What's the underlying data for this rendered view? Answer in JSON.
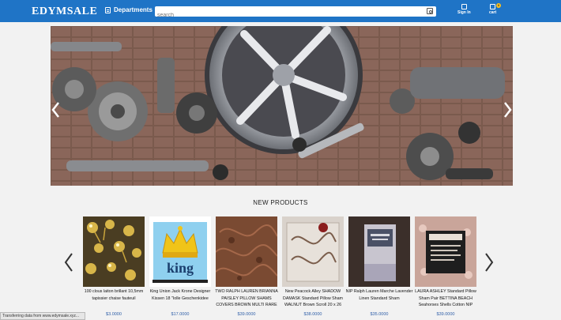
{
  "header": {
    "logo": "EDYMSALE",
    "departments_label": "Departments",
    "search_placeholder": "search",
    "signin_label": "Sign In",
    "cart_label": "cart",
    "cart_count": "0"
  },
  "section_title": "NEW PRODUCTS",
  "products": [
    {
      "name": "100 clous laiton brillant 10,5mm tapissier chaise fauteuil",
      "price": "$3.0000",
      "thumb": "brass-tacks"
    },
    {
      "name": "King Union Jack Krone Designer Kissen 18 \"Iolle Geschenkidee",
      "price": "$17.0000",
      "thumb": "king-pillow"
    },
    {
      "name": "TWO RALPH LAUREN BRIANNA PAISLEY PILLOW SHAMS COVERS BROWN MULTI RARE",
      "price": "$39.0000",
      "thumb": "paisley-sham"
    },
    {
      "name": "New Peacock Alley SHADOW DAMASK Standard Pillow Sham WALNUT Brown Scroll 20 x 26",
      "price": "$38.0000",
      "thumb": "damask-sham"
    },
    {
      "name": "NIP Ralph Lauren Marche Lavender Linen Standard Sham",
      "price": "$35.0000",
      "thumb": "lavender-sham"
    },
    {
      "name": "LAURA ASHLEY Standard Pillow Sham Pair BETTINA BEACH Seahorses Shells Cotton NIP",
      "price": "$39.0000",
      "thumb": "seahorse-sham"
    }
  ],
  "status_bar": "Transferring data from www.edymsale.xyz...",
  "colors": {
    "topbar": "#1f74c6",
    "price": "#2f5fa8",
    "badge": "#ffc21a"
  }
}
